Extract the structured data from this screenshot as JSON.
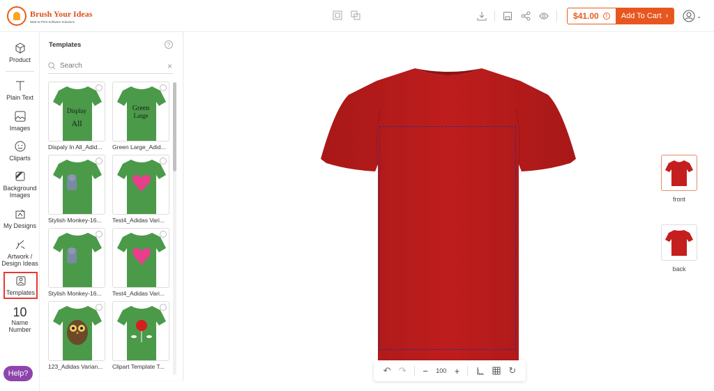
{
  "header": {
    "brand": "Brush Your Ideas",
    "tagline": "Web-to-Print Software Solutions",
    "price": "$41.00",
    "add_to_cart": "Add To Cart"
  },
  "rail": {
    "product": "Product",
    "plain_text": "Plain Text",
    "images": "Images",
    "cliparts": "Cliparts",
    "background_images_1": "Background",
    "background_images_2": "Images",
    "my_designs": "My Designs",
    "artwork_1": "Artwork /",
    "artwork_2": "Design Ideas",
    "templates": "Templates",
    "name_number_glyph": "10",
    "name_number_1": "Name",
    "name_number_2": "Number",
    "help": "Help?"
  },
  "panel": {
    "title": "Templates",
    "search_placeholder": "Search",
    "templates": [
      {
        "label": "Dispaly In All_Adid...",
        "line1": "Display",
        "line2": "All"
      },
      {
        "label": "Green Large_Adid...",
        "line1": "Green",
        "line2": "Large"
      },
      {
        "label": "Stylish Monkey-16..."
      },
      {
        "label": "Test4_Adidas Vari..."
      },
      {
        "label": "Stylish Monkey-16..."
      },
      {
        "label": "Test4_Adidas Vari..."
      },
      {
        "label": "123_Adidas Varian..."
      },
      {
        "label": "Clipart Template T..."
      }
    ]
  },
  "canvas": {
    "zoom": "100",
    "views": [
      "front",
      "back"
    ]
  },
  "colors": {
    "accent": "#e8561f",
    "shirt_red": "#b71c1c",
    "shirt_green": "#4a9a4a",
    "help_purple": "#8e44ad"
  }
}
